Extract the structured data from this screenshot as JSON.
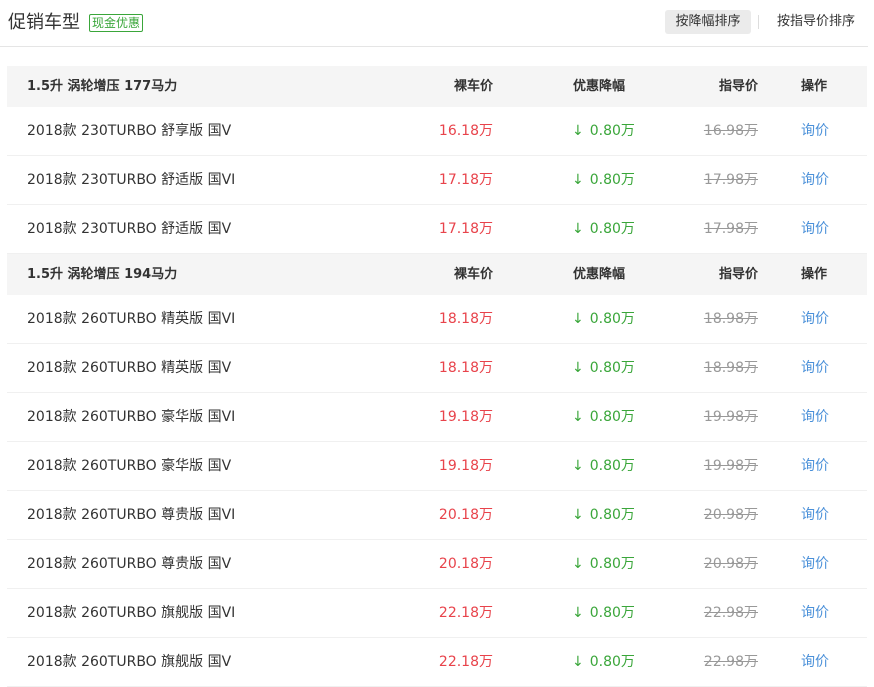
{
  "header": {
    "title": "促销车型",
    "badge": "现金优惠",
    "sort_by_discount": "按降幅排序",
    "sort_by_guide": "按指导价排序"
  },
  "columns": {
    "price": "裸车价",
    "discount": "优惠降幅",
    "guide": "指导价",
    "action": "操作"
  },
  "groups": [
    {
      "label": "1.5升 涡轮增压 177马力",
      "rows": [
        {
          "name": "2018款 230TURBO 舒享版 国V",
          "price": "16.18万",
          "discount": "0.80万",
          "guide": "16.98万",
          "action": "询价"
        },
        {
          "name": "2018款 230TURBO 舒适版 国VI",
          "price": "17.18万",
          "discount": "0.80万",
          "guide": "17.98万",
          "action": "询价"
        },
        {
          "name": "2018款 230TURBO 舒适版 国V",
          "price": "17.18万",
          "discount": "0.80万",
          "guide": "17.98万",
          "action": "询价"
        }
      ]
    },
    {
      "label": "1.5升 涡轮增压 194马力",
      "rows": [
        {
          "name": "2018款 260TURBO 精英版 国VI",
          "price": "18.18万",
          "discount": "0.80万",
          "guide": "18.98万",
          "action": "询价"
        },
        {
          "name": "2018款 260TURBO 精英版 国V",
          "price": "18.18万",
          "discount": "0.80万",
          "guide": "18.98万",
          "action": "询价"
        },
        {
          "name": "2018款 260TURBO 豪华版 国VI",
          "price": "19.18万",
          "discount": "0.80万",
          "guide": "19.98万",
          "action": "询价"
        },
        {
          "name": "2018款 260TURBO 豪华版 国V",
          "price": "19.18万",
          "discount": "0.80万",
          "guide": "19.98万",
          "action": "询价"
        },
        {
          "name": "2018款 260TURBO 尊贵版 国VI",
          "price": "20.18万",
          "discount": "0.80万",
          "guide": "20.98万",
          "action": "询价"
        },
        {
          "name": "2018款 260TURBO 尊贵版 国V",
          "price": "20.18万",
          "discount": "0.80万",
          "guide": "20.98万",
          "action": "询价"
        },
        {
          "name": "2018款 260TURBO 旗舰版 国VI",
          "price": "22.18万",
          "discount": "0.80万",
          "guide": "22.98万",
          "action": "询价"
        },
        {
          "name": "2018款 260TURBO 旗舰版 国V",
          "price": "22.18万",
          "discount": "0.80万",
          "guide": "22.98万",
          "action": "询价"
        }
      ]
    }
  ]
}
